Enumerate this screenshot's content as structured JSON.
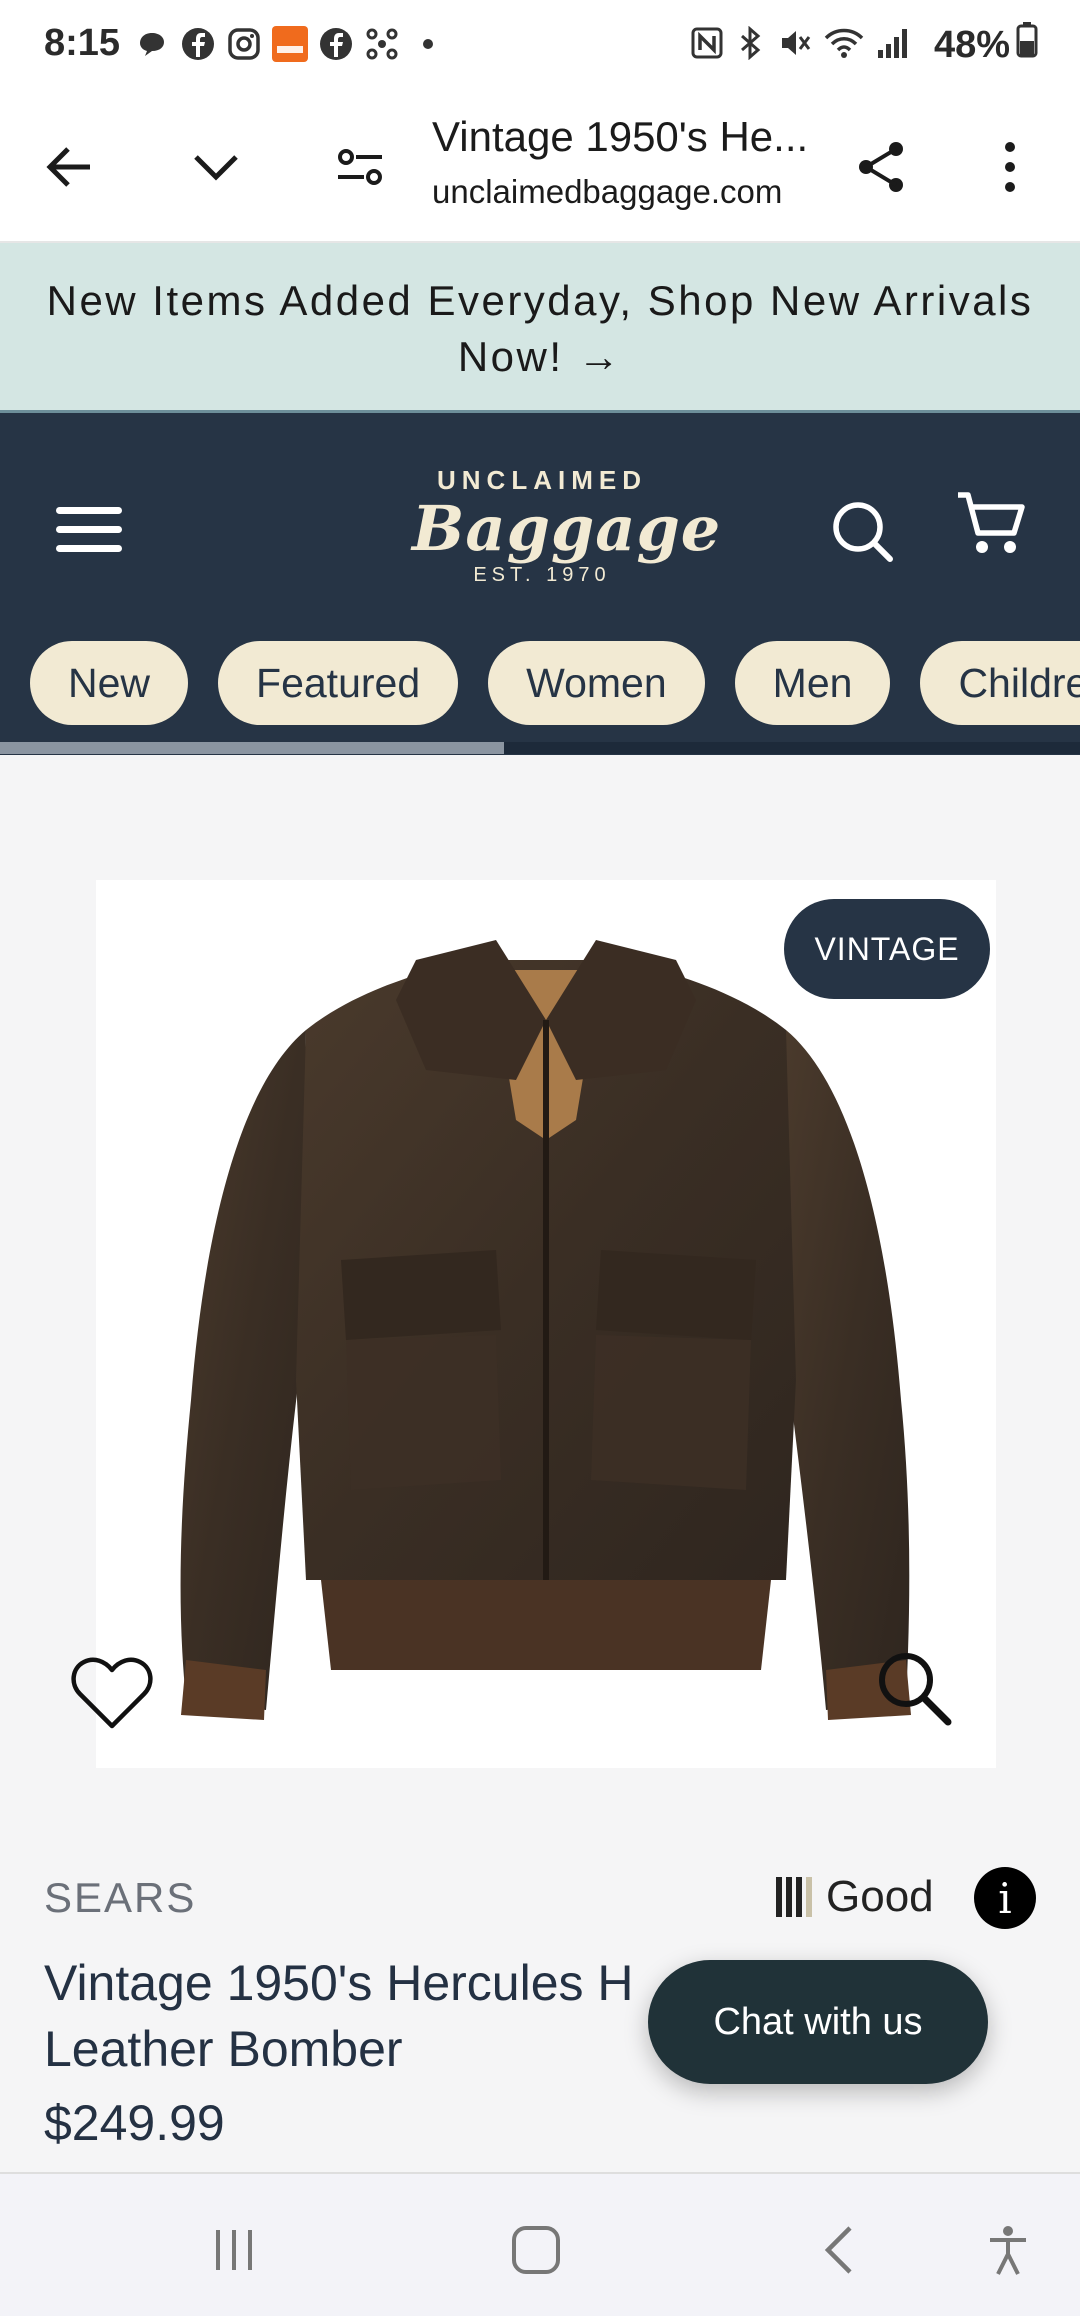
{
  "status_bar": {
    "time": "8:15",
    "battery": "48%"
  },
  "browser": {
    "page_title": "Vintage 1950's He...",
    "url": "unclaimedbaggage.com"
  },
  "promo": {
    "text": "New Items Added Everyday, Shop New Arrivals Now!",
    "arrow": "→"
  },
  "header": {
    "logo_top": "UNCLAIMED",
    "logo_main": "Baggage",
    "logo_sub": "EST. 1970",
    "nav_chips": [
      "New",
      "Featured",
      "Women",
      "Men",
      "Childre"
    ]
  },
  "product": {
    "badge": "VINTAGE",
    "brand": "SEARS",
    "condition": "Good",
    "condition_icon": "condition-bars-icon",
    "name": "Vintage 1950's Hercules H\nLeather Bomber",
    "price": "$249.99"
  },
  "chat_button": "Chat with us",
  "colors": {
    "header_bg": "#263445",
    "chip_bg": "#f2ead3",
    "promo_bg": "#d4e6e3",
    "chat_bg": "#203238"
  }
}
